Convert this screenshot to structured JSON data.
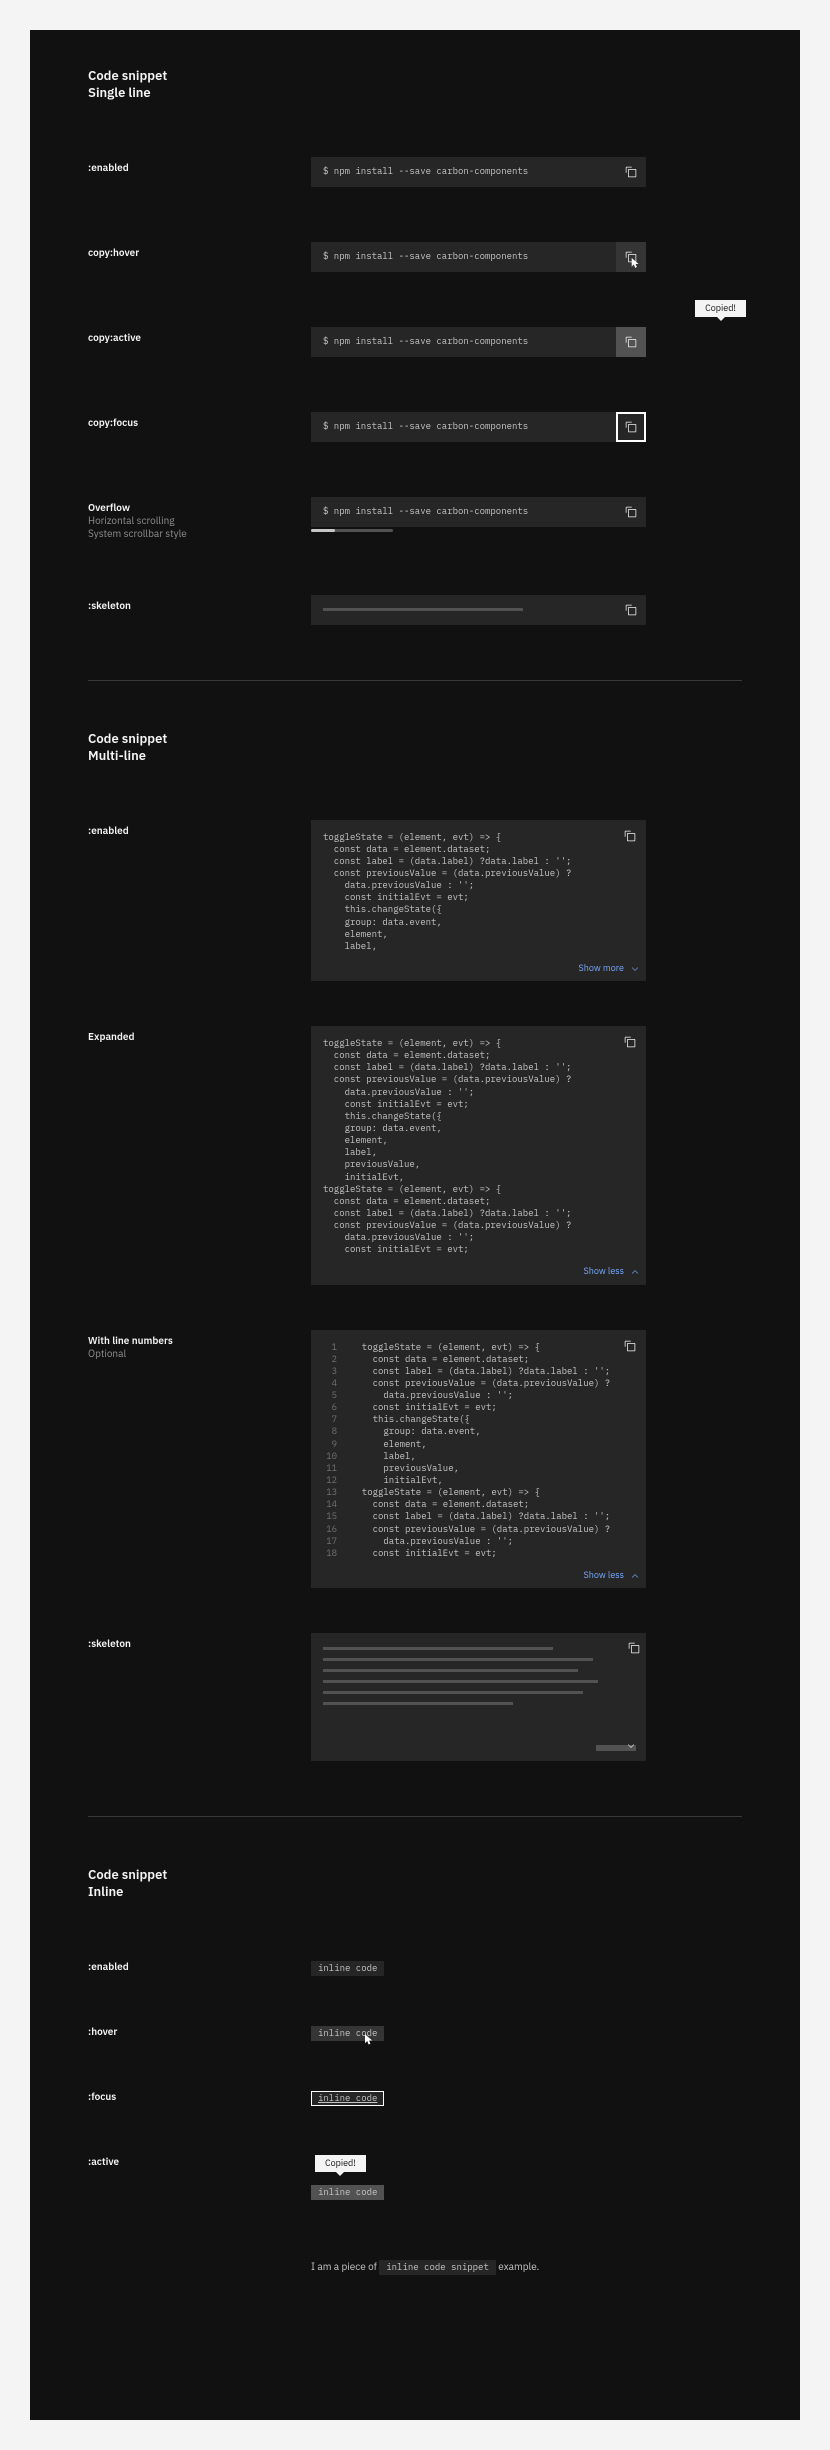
{
  "section1": {
    "title_l1": "Code snippet",
    "title_l2": "Single line",
    "states": {
      "enabled": ":enabled",
      "hover": "copy:hover",
      "active": "copy:active",
      "focus": "copy:focus",
      "overflow_l1": "Overflow",
      "overflow_l2": "Horizontal scrolling",
      "overflow_l3": "System scrollbar style",
      "skeleton": ":skeleton"
    },
    "command": "$ npm install --save carbon-components",
    "tooltip_copied": "Copied!"
  },
  "section2": {
    "title_l1": "Code snippet",
    "title_l2": "Multi-line",
    "states": {
      "enabled": ":enabled",
      "expanded": "Expanded",
      "linenum_l1": "With line numbers",
      "linenum_l2": "Optional",
      "skeleton": ":skeleton"
    },
    "show_more": "Show more",
    "show_less": "Show less",
    "code_short": "toggleState = (element, evt) => {\n  const data = element.dataset;\n  const label = (data.label) ?data.label : '';\n  const previousValue = (data.previousValue) ?\n    data.previousValue : '';\n    const initialEvt = evt;\n    this.changeState({\n    group: data.event,\n    element,\n    label,",
    "code_long": "toggleState = (element, evt) => {\n  const data = element.dataset;\n  const label = (data.label) ?data.label : '';\n  const previousValue = (data.previousValue) ?\n    data.previousValue : '';\n    const initialEvt = evt;\n    this.changeState({\n    group: data.event,\n    element,\n    label,\n    previousValue,\n    initialEvt,\ntoggleState = (element, evt) => {\n  const data = element.dataset;\n  const label = (data.label) ?data.label : '';\n  const previousValue = (data.previousValue) ?\n    data.previousValue : '';\n    const initialEvt = evt;",
    "code_lines": "  toggleState = (element, evt) => {\n    const data = element.dataset;\n    const label = (data.label) ?data.label : '';\n    const previousValue = (data.previousValue) ?\n      data.previousValue : '';\n    const initialEvt = evt;\n    this.changeState({\n      group: data.event,\n      element,\n      label,\n      previousValue,\n      initialEvt,\n  toggleState = (element, evt) => {\n    const data = element.dataset;\n    const label = (data.label) ?data.label : '';\n    const previousValue = (data.previousValue) ?\n      data.previousValue : '';\n    const initialEvt = evt;",
    "gutter": "1\n2\n3\n4\n5\n6\n7\n8\n9\n10\n11\n12\n13\n14\n15\n16\n17\n18"
  },
  "section3": {
    "title_l1": "Code snippet",
    "title_l2": "Inline",
    "states": {
      "enabled": ":enabled",
      "hover": ":hover",
      "focus": ":focus",
      "active": ":active"
    },
    "inline_text": "inline code",
    "tooltip_copied": "Copied!",
    "sentence_pre": "I am a piece of ",
    "sentence_code": "inline code snippet",
    "sentence_post": " example."
  }
}
